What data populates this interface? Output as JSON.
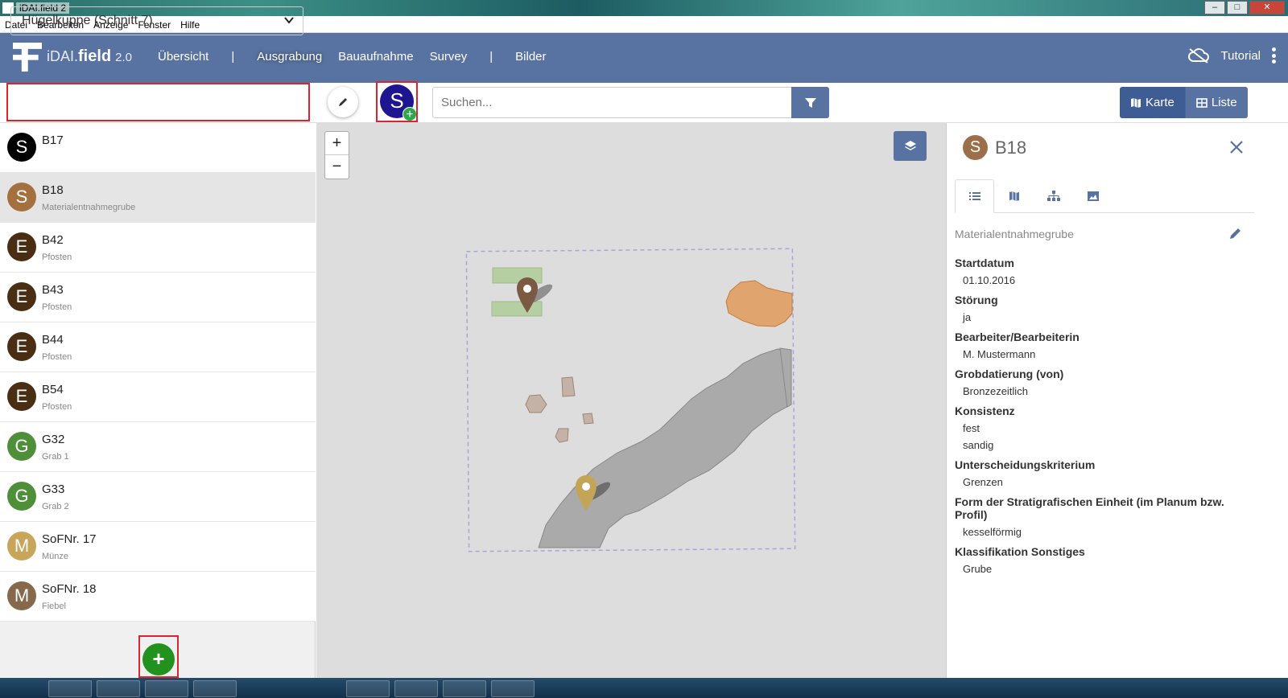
{
  "window": {
    "title": "iDAI.field 2"
  },
  "menu": [
    "Datei",
    "Bearbeiten",
    "Anzeige",
    "Fenster",
    "Hilfe"
  ],
  "navbar": {
    "logo_idai": "iDAI.",
    "logo_field": "field",
    "logo_version": "2.0",
    "items": [
      "Übersicht",
      "|",
      "Ausgrabung",
      "Bauaufnahme",
      "Survey",
      "|",
      "Bilder"
    ],
    "active": "Ausgrabung",
    "tutorial": "Tutorial",
    "color": "#5872a1"
  },
  "toolbar": {
    "operation_select": "Hügelkuppe (Schnitt 7)",
    "add_type_letter": "S",
    "search_placeholder": "Suchen...",
    "view_map": "Karte",
    "view_list": "Liste"
  },
  "resources": [
    {
      "letter": "S",
      "color": "#000000",
      "identifier": "B17",
      "short": ""
    },
    {
      "letter": "S",
      "color": "#a4703f",
      "identifier": "B18",
      "short": "Materialentnahmegrube",
      "selected": true
    },
    {
      "letter": "E",
      "color": "#4a2e14",
      "identifier": "B42",
      "short": "Pfosten"
    },
    {
      "letter": "E",
      "color": "#4a2e14",
      "identifier": "B43",
      "short": "Pfosten"
    },
    {
      "letter": "E",
      "color": "#4a2e14",
      "identifier": "B44",
      "short": "Pfosten"
    },
    {
      "letter": "E",
      "color": "#4a2e14",
      "identifier": "B54",
      "short": "Pfosten"
    },
    {
      "letter": "G",
      "color": "#4f8f3a",
      "identifier": "G32",
      "short": "Grab 1"
    },
    {
      "letter": "G",
      "color": "#4f8f3a",
      "identifier": "G33",
      "short": "Grab 2"
    },
    {
      "letter": "M",
      "color": "#c8a55a",
      "identifier": "SoFNr. 17",
      "short": "Münze"
    },
    {
      "letter": "M",
      "color": "#86684b",
      "identifier": "SoFNr. 18",
      "short": "Fiebel"
    }
  ],
  "map": {
    "zoom_in": "+",
    "zoom_out": "−"
  },
  "detail": {
    "letter": "S",
    "identifier": "B18",
    "category": "Materialentnahmegrube",
    "fields": [
      {
        "label": "Startdatum",
        "values": [
          "01.10.2016"
        ]
      },
      {
        "label": "Störung",
        "values": [
          "ja"
        ]
      },
      {
        "label": "Bearbeiter/Bearbeiterin",
        "values": [
          "M. Mustermann"
        ]
      },
      {
        "label": "Grobdatierung (von)",
        "values": [
          "Bronzezeitlich"
        ]
      },
      {
        "label": "Konsistenz",
        "values": [
          "fest",
          "sandig"
        ]
      },
      {
        "label": "Unterscheidungskriterium",
        "values": [
          "Grenzen"
        ]
      },
      {
        "label": "Form der Stratigrafischen Einheit (im Planum bzw. Profil)",
        "values": [
          "kesselförmig"
        ]
      },
      {
        "label": "Klassifikation Sonstiges",
        "values": [
          "Grube"
        ]
      }
    ]
  }
}
